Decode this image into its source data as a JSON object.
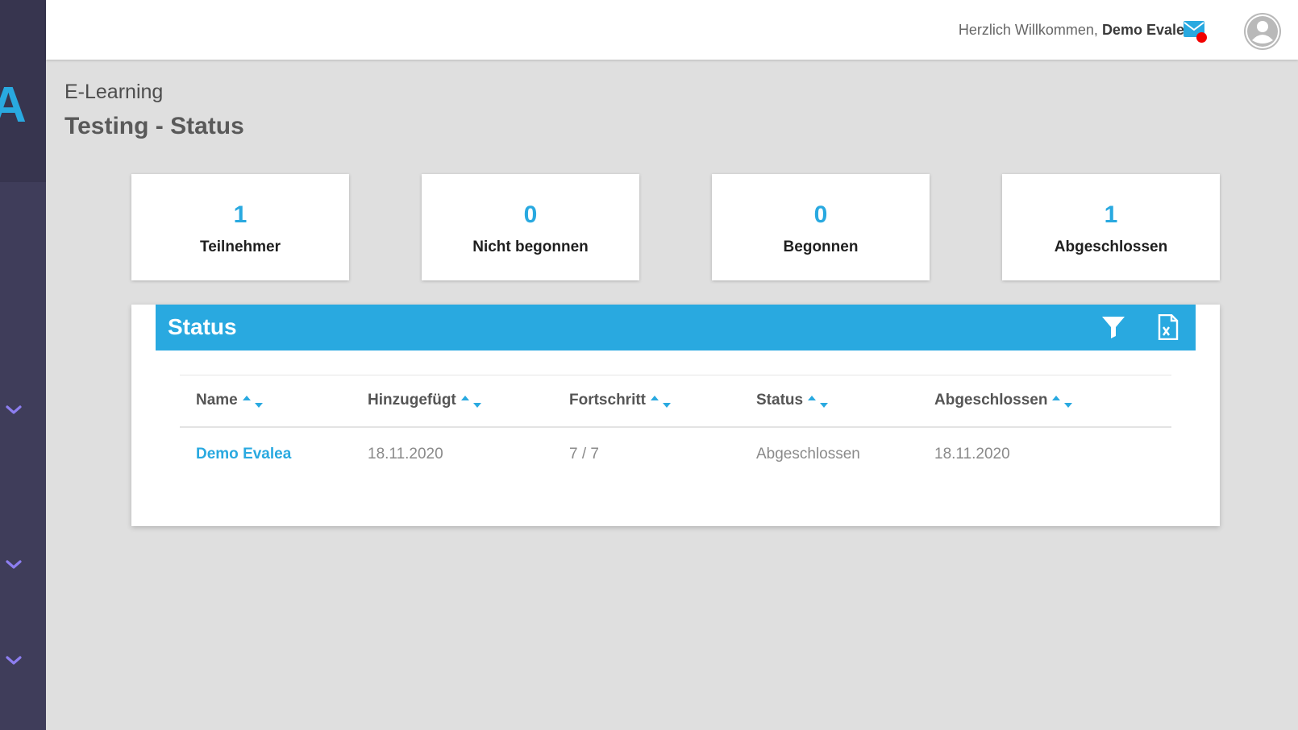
{
  "sidebar": {
    "logo_letter": "A",
    "chevrons": [
      "chevron-down-icon",
      "chevron-down-icon",
      "chevron-down-icon"
    ],
    "accent_color": "#8d7ef0"
  },
  "topbar": {
    "welcome_text": "Herzlich Willkommen,",
    "user_name": "Demo Evalea",
    "mail_icon": "mail-icon",
    "notification_color": "#f20000",
    "avatar_icon": "user-avatar-icon"
  },
  "header": {
    "breadcrumb": "E-Learning",
    "title": "Testing - Status"
  },
  "stats": [
    {
      "value": "1",
      "label": "Teilnehmer"
    },
    {
      "value": "0",
      "label": "Nicht begonnen"
    },
    {
      "value": "0",
      "label": "Begonnen"
    },
    {
      "value": "1",
      "label": "Abgeschlossen"
    }
  ],
  "panel": {
    "title": "Status",
    "filter_icon": "filter-icon",
    "export_icon": "excel-export-icon",
    "accent_color": "#29a9e0"
  },
  "table": {
    "columns": [
      "Name",
      "Hinzugefügt",
      "Fortschritt",
      "Status",
      "Abgeschlossen"
    ],
    "rows": [
      {
        "name": "Demo Evalea",
        "added": "18.11.2020",
        "progress": "7 / 7",
        "status": "Abgeschlossen",
        "completed": "18.11.2020"
      }
    ]
  }
}
